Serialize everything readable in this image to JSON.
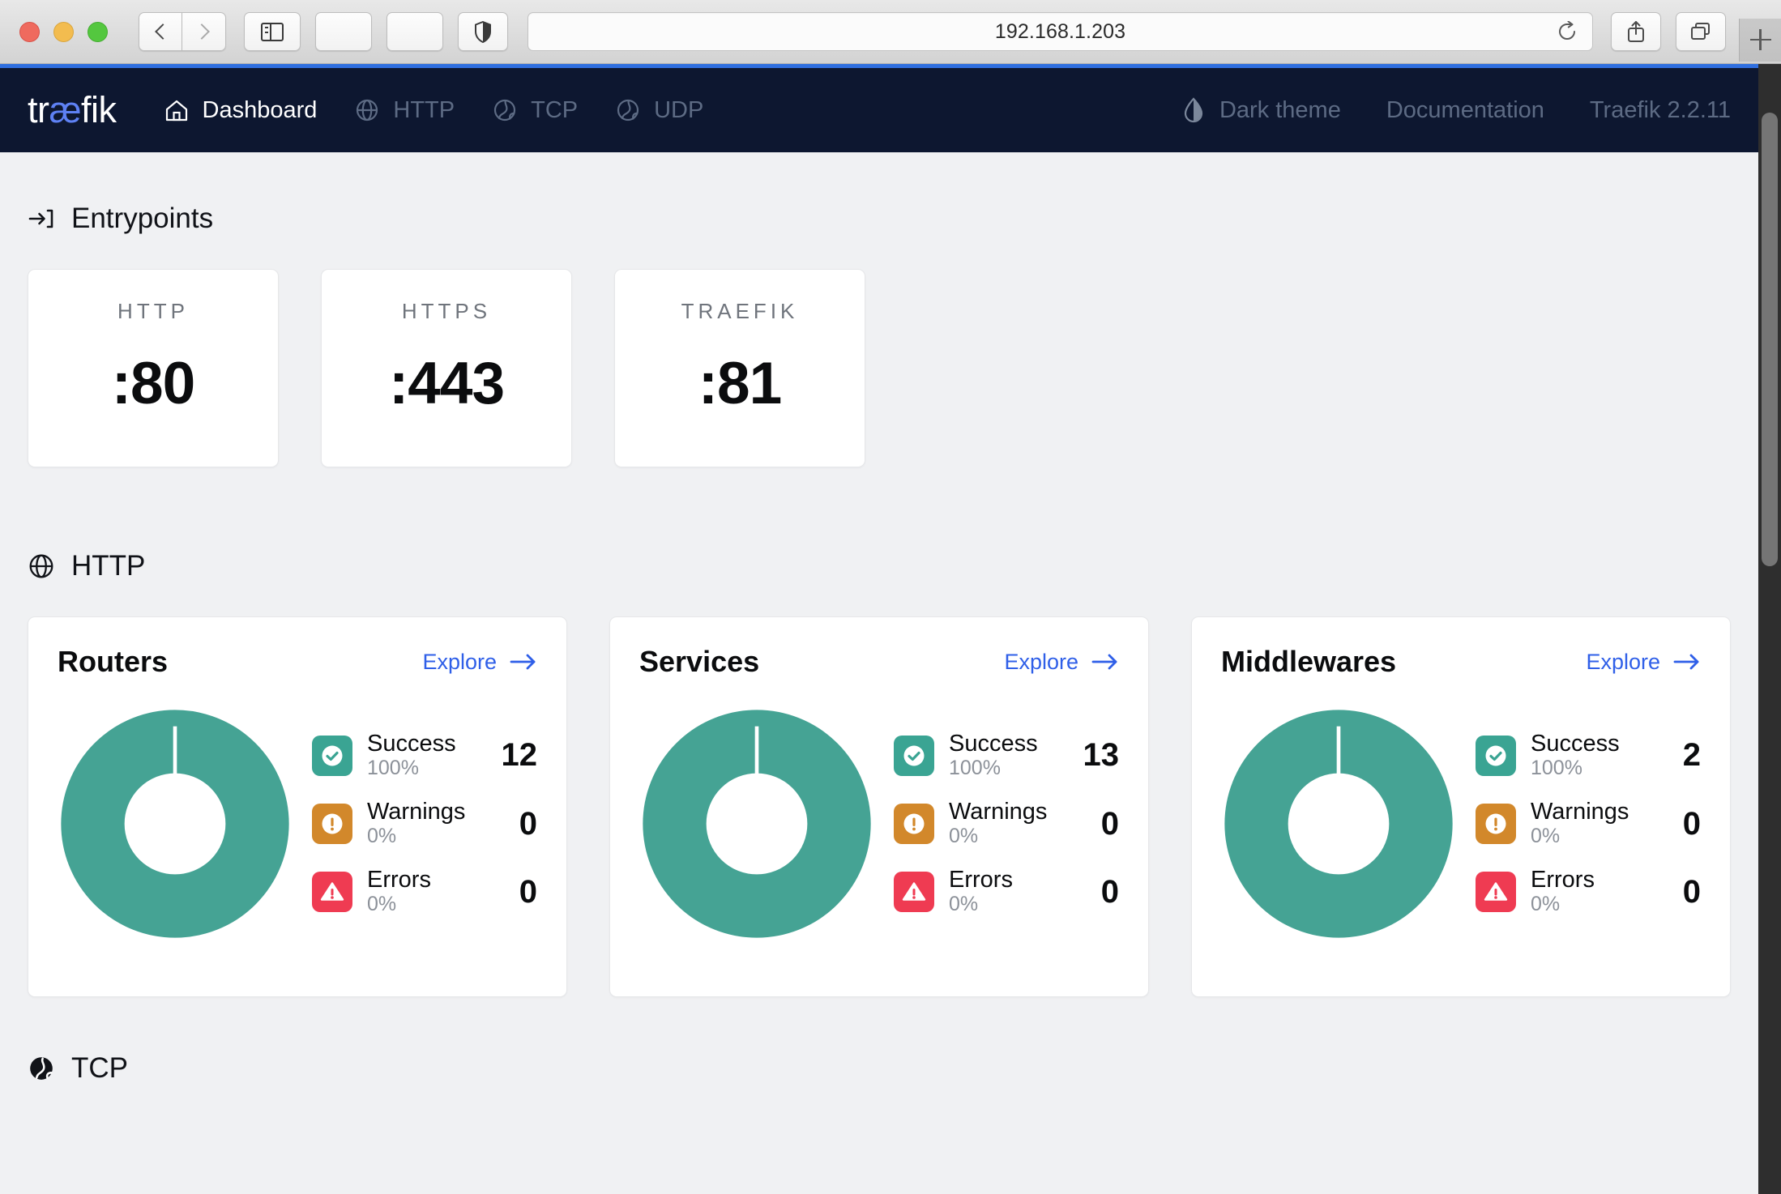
{
  "browser": {
    "url": "192.168.1.203",
    "back_icon": "chevron-left-icon",
    "forward_icon": "chevron-right-icon",
    "sidebar_icon": "sidebar-toggle-icon",
    "shield_icon": "shield-icon",
    "reload_icon": "reload-icon",
    "share_icon": "share-icon",
    "tabs_icon": "tab-overview-icon",
    "newtab_icon": "plus-icon"
  },
  "navbar": {
    "logo_pre": "tr",
    "logo_ae": "æ",
    "logo_post": "fik",
    "items": [
      {
        "label": "Dashboard",
        "icon": "home-icon",
        "active": true
      },
      {
        "label": "HTTP",
        "icon": "globe-icon",
        "active": false
      },
      {
        "label": "TCP",
        "icon": "globe-wave-icon",
        "active": false
      },
      {
        "label": "UDP",
        "icon": "globe-wave-icon",
        "active": false
      }
    ],
    "right_items": [
      {
        "label": "Dark theme",
        "icon": "droplet-half-icon"
      },
      {
        "label": "Documentation",
        "icon": ""
      },
      {
        "label": "Traefik 2.2.11",
        "icon": ""
      }
    ]
  },
  "entrypoints": {
    "section_title": "Entrypoints",
    "section_icon": "arrow-into-bracket-icon",
    "cards": [
      {
        "name": "HTTP",
        "port": ":80"
      },
      {
        "name": "HTTPS",
        "port": ":443"
      },
      {
        "name": "TRAEFIK",
        "port": ":81"
      }
    ]
  },
  "http_section": {
    "section_title": "HTTP",
    "section_icon": "globe-icon",
    "explore_label": "Explore",
    "cards": [
      {
        "title": "Routers",
        "stats": [
          {
            "label": "Success",
            "pct": "100%",
            "count": "12",
            "kind": "success"
          },
          {
            "label": "Warnings",
            "pct": "0%",
            "count": "0",
            "kind": "warning"
          },
          {
            "label": "Errors",
            "pct": "0%",
            "count": "0",
            "kind": "error"
          }
        ]
      },
      {
        "title": "Services",
        "stats": [
          {
            "label": "Success",
            "pct": "100%",
            "count": "13",
            "kind": "success"
          },
          {
            "label": "Warnings",
            "pct": "0%",
            "count": "0",
            "kind": "warning"
          },
          {
            "label": "Errors",
            "pct": "0%",
            "count": "0",
            "kind": "error"
          }
        ]
      },
      {
        "title": "Middlewares",
        "stats": [
          {
            "label": "Success",
            "pct": "100%",
            "count": "2",
            "kind": "success"
          },
          {
            "label": "Warnings",
            "pct": "0%",
            "count": "0",
            "kind": "warning"
          },
          {
            "label": "Errors",
            "pct": "0%",
            "count": "0",
            "kind": "error"
          }
        ]
      }
    ]
  },
  "tcp_section": {
    "section_title": "TCP",
    "section_icon": "globe-wave-solid-icon"
  },
  "colors": {
    "navbar_bg": "#0d1730",
    "accent_blue": "#2f6fe0",
    "link_blue": "#2f5fe8",
    "logo_blue": "#5e81f4",
    "success": "#3aa493",
    "warning": "#d2882b",
    "error": "#ef3b52",
    "page_bg": "#f0f1f3",
    "card_bg": "#ffffff"
  },
  "chart_data": [
    {
      "type": "pie",
      "title": "Routers",
      "labels": [
        "Success",
        "Warnings",
        "Errors"
      ],
      "values": [
        12,
        0,
        0
      ],
      "percentages": [
        100,
        0,
        0
      ],
      "colors": [
        "#3aa493",
        "#d2882b",
        "#ef3b52"
      ],
      "donut": true,
      "legend": "right"
    },
    {
      "type": "pie",
      "title": "Services",
      "labels": [
        "Success",
        "Warnings",
        "Errors"
      ],
      "values": [
        13,
        0,
        0
      ],
      "percentages": [
        100,
        0,
        0
      ],
      "colors": [
        "#3aa493",
        "#d2882b",
        "#ef3b52"
      ],
      "donut": true,
      "legend": "right"
    },
    {
      "type": "pie",
      "title": "Middlewares",
      "labels": [
        "Success",
        "Warnings",
        "Errors"
      ],
      "values": [
        2,
        0,
        0
      ],
      "percentages": [
        100,
        0,
        0
      ],
      "colors": [
        "#3aa493",
        "#d2882b",
        "#ef3b52"
      ],
      "donut": true,
      "legend": "right"
    }
  ]
}
